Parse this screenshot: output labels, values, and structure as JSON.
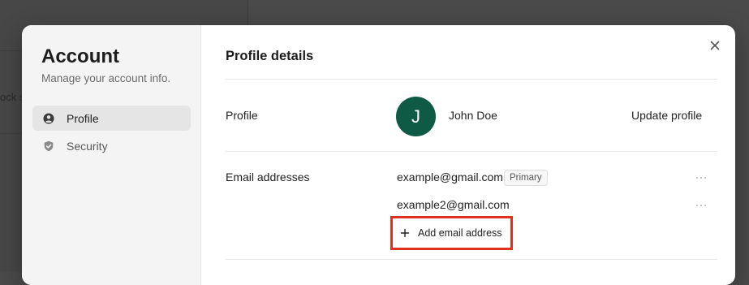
{
  "background": {
    "snippet": "ock s"
  },
  "sidebar": {
    "title": "Account",
    "subtitle": "Manage your account info.",
    "items": [
      {
        "label": "Profile",
        "icon": "user-circle-icon",
        "active": true
      },
      {
        "label": "Security",
        "icon": "shield-icon",
        "active": false
      }
    ]
  },
  "main": {
    "title": "Profile details",
    "close_icon": "close-icon",
    "profile": {
      "label": "Profile",
      "avatar_initial": "J",
      "avatar_color": "#0f5a45",
      "name": "John Doe",
      "update_label": "Update profile"
    },
    "emails": {
      "label": "Email addresses",
      "items": [
        {
          "address": "example@gmail.com",
          "badge": "Primary"
        },
        {
          "address": "example2@gmail.com",
          "badge": ""
        }
      ],
      "add_label": "Add email address",
      "highlight_color": "#e0301e"
    }
  }
}
